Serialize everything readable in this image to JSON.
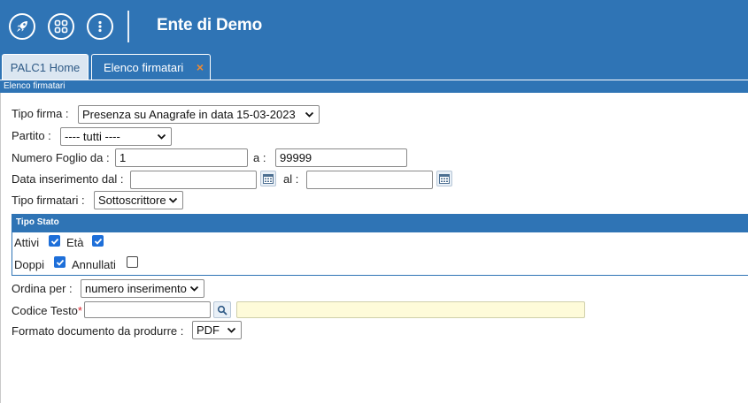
{
  "header": {
    "title": "Ente di Demo",
    "icons": [
      "rocket-icon",
      "apps-grid-icon",
      "more-vertical-icon"
    ]
  },
  "tabs": [
    {
      "label": "PALC1 Home",
      "active": false
    },
    {
      "label": "Elenco firmatari",
      "active": true,
      "close": "×"
    }
  ],
  "breadcrumb": "Elenco firmatari",
  "form": {
    "tipo_firma": {
      "label": "Tipo firma :",
      "value": "Presenza su Anagrafe in data 15-03-2023"
    },
    "partito": {
      "label": "Partito :",
      "value": "---- tutti ----"
    },
    "numero_foglio": {
      "label": "Numero Foglio da :",
      "from": "1",
      "to_label": "a :",
      "to": "99999"
    },
    "data_inserimento": {
      "label": "Data inserimento dal :",
      "from": "",
      "to_label": "al :",
      "to": ""
    },
    "tipo_firmatari": {
      "label": "Tipo firmatari :",
      "value": "Sottoscrittore"
    },
    "tipo_stato": {
      "title": "Tipo Stato",
      "attivi": {
        "label": "Attivi",
        "checked": true
      },
      "eta": {
        "label": "Età",
        "checked": true
      },
      "doppi": {
        "label": "Doppi",
        "checked": true
      },
      "annullati": {
        "label": "Annullati",
        "checked": false
      }
    },
    "ordina_per": {
      "label": "Ordina per :",
      "value": "numero inserimento"
    },
    "codice_testo": {
      "label": "Codice Testo",
      "required_mark": "*",
      "value": "",
      "description": ""
    },
    "formato": {
      "label": "Formato documento da produrre :",
      "value": "PDF"
    }
  },
  "colors": {
    "primary": "#2f74b5",
    "accent": "#f08a30",
    "checkbox": "#1e6fd9",
    "required": "#d9232d",
    "readonly_bg": "#fefbd9"
  }
}
